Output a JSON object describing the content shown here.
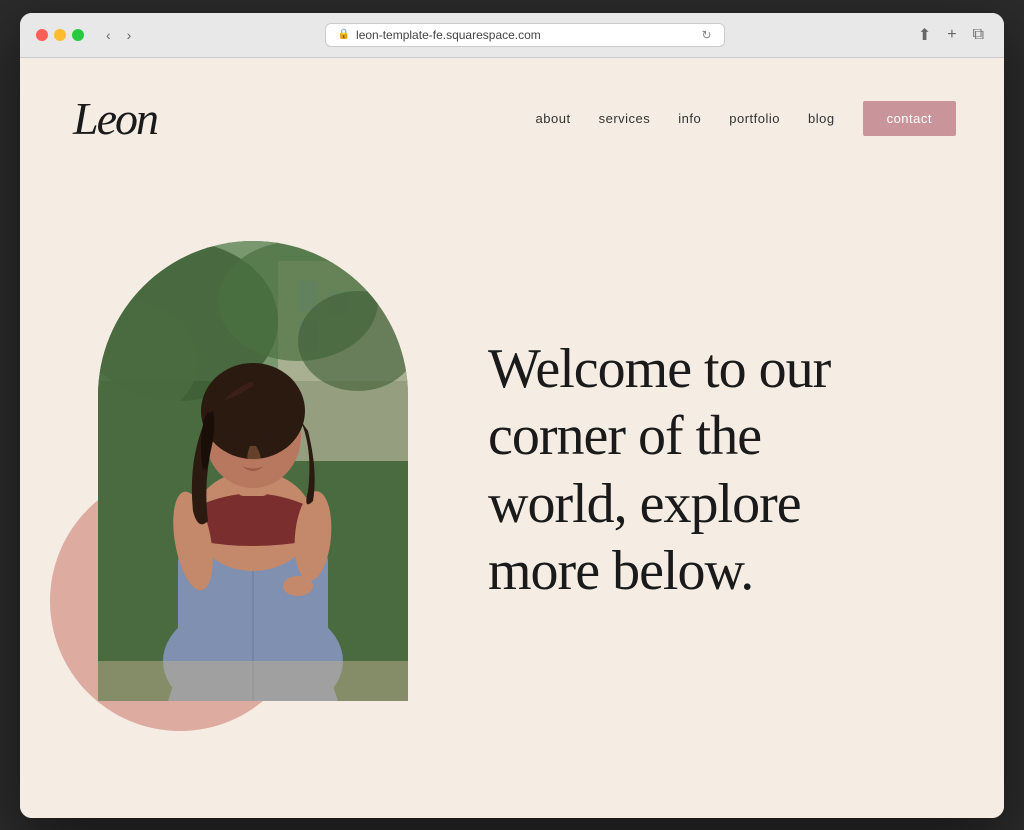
{
  "browser": {
    "url": "leon-template-fe.squarespace.com",
    "controls": {
      "back": "‹",
      "forward": "›",
      "refresh": "↻"
    }
  },
  "website": {
    "logo": "Leon",
    "nav": {
      "links": [
        {
          "label": "about",
          "href": "#"
        },
        {
          "label": "services",
          "href": "#"
        },
        {
          "label": "info",
          "href": "#"
        },
        {
          "label": "portfolio",
          "href": "#"
        },
        {
          "label": "blog",
          "href": "#"
        }
      ],
      "contact_button": "contact"
    },
    "hero": {
      "heading_line1": "Welcome to our",
      "heading_line2": "corner of the",
      "heading_line3": "world, explore",
      "heading_line4": "more below."
    }
  },
  "colors": {
    "background": "#f5ede3",
    "pink_circle": "#d4948a",
    "contact_btn": "#c9959a",
    "nav_text": "#333333",
    "heading_text": "#1a1a1a"
  }
}
